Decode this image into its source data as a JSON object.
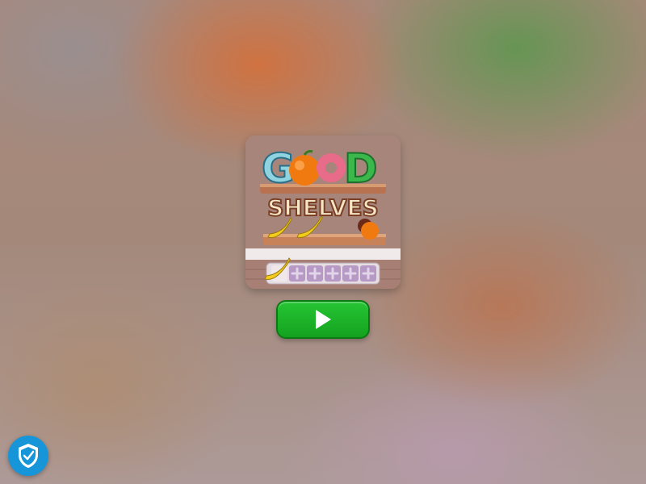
{
  "game": {
    "title_top": "GOOD",
    "title_bottom": "SHELVES",
    "title_letter_g": "G",
    "title_letter_d": "D"
  },
  "play_button": {
    "icon": "play-icon"
  },
  "privacy_badge": {
    "icon": "shield-check-icon",
    "color": "#1696d8"
  },
  "colors": {
    "play_green": "#1bb328",
    "shelf_wood": "#c8825a",
    "title_cream": "#f5e6c8"
  },
  "slots": {
    "filled": 1,
    "total": 6
  }
}
